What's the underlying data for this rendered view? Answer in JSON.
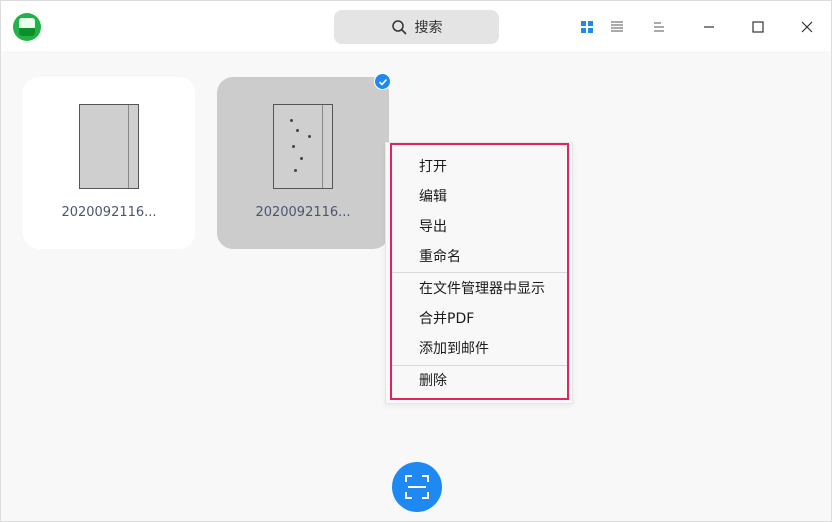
{
  "titlebar": {
    "search": {
      "label": "搜索",
      "icon": "search-icon"
    },
    "icons": [
      "grid-view-icon",
      "list-view-icon",
      "menu-icon",
      "minimize-icon",
      "maximize-icon",
      "close-icon"
    ]
  },
  "documents": [
    {
      "name": "2020092116...",
      "selected": false
    },
    {
      "name": "2020092116...",
      "selected": true
    }
  ],
  "context_menu": {
    "groups": [
      [
        "打开",
        "编辑",
        "导出",
        "重命名"
      ],
      [
        "在文件管理器中显示",
        "合并PDF",
        "添加到邮件"
      ],
      [
        "删除"
      ]
    ]
  },
  "colors": {
    "accent": "#1e88f3",
    "highlight_frame": "#e0245e",
    "app_icon": "#22b347"
  }
}
